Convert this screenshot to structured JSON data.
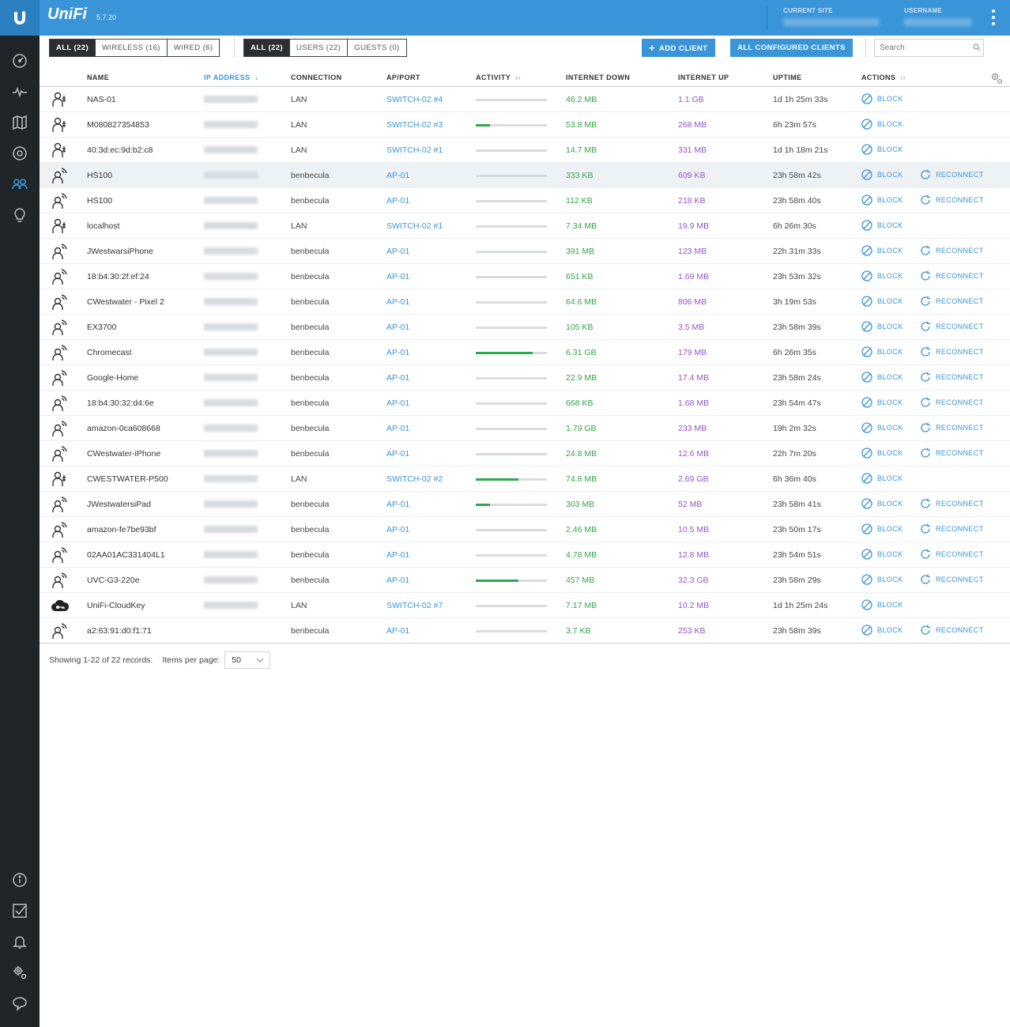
{
  "header": {
    "brand": "UniFi",
    "version": "5.7.20",
    "current_site_label": "CURRENT SITE",
    "username_label": "USERNAME"
  },
  "sidebar": {
    "top_items": [
      "dashboard-icon",
      "statistics-icon",
      "map-icon",
      "devices-icon",
      "clients-icon",
      "insights-icon"
    ],
    "bottom_items": [
      "info-icon",
      "tasks-icon",
      "alerts-icon",
      "settings-icon",
      "chat-icon"
    ],
    "active": "clients-icon"
  },
  "toolbar": {
    "type_filters": [
      "ALL (22)",
      "WIRELESS (16)",
      "WIRED (6)"
    ],
    "user_filters": [
      "ALL (22)",
      "USERS (22)",
      "GUESTS (0)"
    ],
    "add_client": "ADD CLIENT",
    "all_configured": "ALL CONFIGURED CLIENTS",
    "search_placeholder": "Search"
  },
  "table": {
    "headers": {
      "name": "NAME",
      "ip": "IP ADDRESS",
      "ip_sort": "↓",
      "connection": "CONNECTION",
      "ap_port": "AP/PORT",
      "activity": "ACTIVITY",
      "activity_arrows": "‹›",
      "down": "INTERNET DOWN",
      "up": "INTERNET UP",
      "uptime": "UPTIME",
      "actions": "ACTIONS",
      "actions_arrows": "‹›"
    },
    "block_label": "BLOCK",
    "reconnect_label": "RECONNECT",
    "rows": [
      {
        "icon": "wired",
        "name": "NAS-01",
        "conn": "LAN",
        "ap": "SWITCH-02 #4",
        "act": 0,
        "down": "46.2 MB",
        "up": "1.1 GB",
        "uptime": "1d 1h 25m 33s",
        "reconnect": false
      },
      {
        "icon": "wired",
        "name": "M080827354853",
        "conn": "LAN",
        "ap": "SWITCH-02 #3",
        "act": 0.2,
        "down": "53.8 MB",
        "up": "268 MB",
        "uptime": "6h 23m 57s",
        "reconnect": false
      },
      {
        "icon": "wired",
        "name": "40:3d:ec:9d:b2:c8",
        "conn": "LAN",
        "ap": "SWITCH-02 #1",
        "act": 0,
        "down": "14.7 MB",
        "up": "331 MB",
        "uptime": "1d 1h 18m 21s",
        "reconnect": false
      },
      {
        "icon": "wireless",
        "name": "HS100",
        "conn": "benbecula",
        "ap": "AP-01",
        "act": 0,
        "down": "333 KB",
        "up": "609 KB",
        "uptime": "23h 58m 42s",
        "reconnect": true,
        "highlight": true
      },
      {
        "icon": "wireless",
        "name": "HS100",
        "conn": "benbecula",
        "ap": "AP-01",
        "act": 0,
        "down": "112 KB",
        "up": "218 KB",
        "uptime": "23h 58m 40s",
        "reconnect": true
      },
      {
        "icon": "wired",
        "name": "localhost",
        "conn": "LAN",
        "ap": "SWITCH-02 #1",
        "act": 0,
        "down": "7.34 MB",
        "up": "19.9 MB",
        "uptime": "6h 26m 30s",
        "reconnect": false
      },
      {
        "icon": "wireless",
        "name": "JWestwarsiPhone",
        "conn": "benbecula",
        "ap": "AP-01",
        "act": 0,
        "down": "391 MB",
        "up": "123 MB",
        "uptime": "22h 31m 33s",
        "reconnect": true
      },
      {
        "icon": "wireless",
        "name": "18:b4:30:2f:ef:24",
        "conn": "benbecula",
        "ap": "AP-01",
        "act": 0,
        "down": "651 KB",
        "up": "1.69 MB",
        "uptime": "23h 53m 32s",
        "reconnect": true
      },
      {
        "icon": "wireless",
        "name": "CWestwater - Pixel 2",
        "conn": "benbecula",
        "ap": "AP-01",
        "act": 0,
        "down": "64.6 MB",
        "up": "806 MB",
        "uptime": "3h 19m 53s",
        "reconnect": true
      },
      {
        "icon": "wireless",
        "name": "EX3700",
        "conn": "benbecula",
        "ap": "AP-01",
        "act": 0,
        "down": "105 KB",
        "up": "3.5 MB",
        "uptime": "23h 58m 39s",
        "reconnect": true
      },
      {
        "icon": "wireless",
        "name": "Chromecast",
        "conn": "benbecula",
        "ap": "AP-01",
        "act": 0.8,
        "down": "6.31 GB",
        "up": "179 MB",
        "uptime": "6h 26m 35s",
        "reconnect": true
      },
      {
        "icon": "wireless",
        "name": "Google-Home",
        "conn": "benbecula",
        "ap": "AP-01",
        "act": 0,
        "down": "22.9 MB",
        "up": "17.4 MB",
        "uptime": "23h 58m 24s",
        "reconnect": true
      },
      {
        "icon": "wireless",
        "name": "18:b4:30:32:d4:6e",
        "conn": "benbecula",
        "ap": "AP-01",
        "act": 0,
        "down": "668 KB",
        "up": "1.68 MB",
        "uptime": "23h 54m 47s",
        "reconnect": true
      },
      {
        "icon": "wireless",
        "name": "amazon-0ca608668",
        "conn": "benbecula",
        "ap": "AP-01",
        "act": 0,
        "down": "1.79 GB",
        "up": "233 MB",
        "uptime": "19h 2m 32s",
        "reconnect": true
      },
      {
        "icon": "wireless",
        "name": "CWestwater-iPhone",
        "conn": "benbecula",
        "ap": "AP-01",
        "act": 0,
        "down": "24.8 MB",
        "up": "12.6 MB",
        "uptime": "22h 7m 20s",
        "reconnect": true
      },
      {
        "icon": "wired",
        "name": "CWESTWATER-P500",
        "conn": "LAN",
        "ap": "SWITCH-02 #2",
        "act": 0.6,
        "down": "74.8 MB",
        "up": "2.69 GB",
        "uptime": "6h 36m 40s",
        "reconnect": false
      },
      {
        "icon": "wireless",
        "name": "JWestwatersiPad",
        "conn": "benbecula",
        "ap": "AP-01",
        "act": 0.2,
        "down": "303 MB",
        "up": "52 MB",
        "uptime": "23h 58m 41s",
        "reconnect": true
      },
      {
        "icon": "wireless",
        "name": "amazon-fe7be93bf",
        "conn": "benbecula",
        "ap": "AP-01",
        "act": 0,
        "down": "2.46 MB",
        "up": "10.5 MB",
        "uptime": "23h 50m 17s",
        "reconnect": true
      },
      {
        "icon": "wireless",
        "name": "02AA01AC331404L1",
        "conn": "benbecula",
        "ap": "AP-01",
        "act": 0,
        "down": "4.78 MB",
        "up": "12.8 MB",
        "uptime": "23h 54m 51s",
        "reconnect": true
      },
      {
        "icon": "wireless",
        "name": "UVC-G3-220e",
        "conn": "benbecula",
        "ap": "AP-01",
        "act": 0.6,
        "down": "457 MB",
        "up": "32.3 GB",
        "uptime": "23h 58m 29s",
        "reconnect": true
      },
      {
        "icon": "cloudkey",
        "name": "UniFi-CloudKey",
        "conn": "LAN",
        "ap": "SWITCH-02 #7",
        "act": 0,
        "down": "7.17 MB",
        "up": "10.2 MB",
        "uptime": "1d 1h 25m 24s",
        "reconnect": false
      },
      {
        "icon": "wireless",
        "name": "a2:63:91:d0:f1:71",
        "conn": "benbecula",
        "ap": "AP-01",
        "act": 0,
        "down": "3.7 KB",
        "up": "253 KB",
        "uptime": "23h 58m 39s",
        "reconnect": true,
        "no_ip": true
      }
    ]
  },
  "footer": {
    "summary": "Showing 1-22 of 22 records.",
    "per_page_label": "Items per page:",
    "per_page_value": "50"
  },
  "colors": {
    "header_blue": "#3a95d8",
    "sidebar_bg": "#1f2529",
    "down_green": "#36a34a",
    "up_purple": "#9157c7",
    "link_blue": "#3a95d8"
  }
}
